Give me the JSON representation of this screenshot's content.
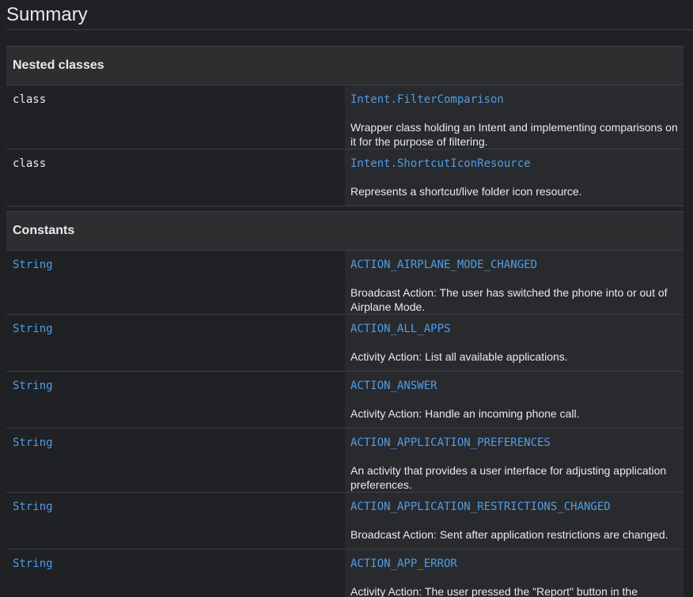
{
  "page": {
    "title": "Summary"
  },
  "nested_classes": {
    "heading": "Nested classes",
    "rows": [
      {
        "type": "class",
        "name": "Intent.FilterComparison",
        "description": "Wrapper class holding an Intent and implementing comparisons on it for the purpose of filtering."
      },
      {
        "type": "class",
        "name": "Intent.ShortcutIconResource",
        "description": "Represents a shortcut/live folder icon resource."
      }
    ]
  },
  "constants": {
    "heading": "Constants",
    "rows": [
      {
        "type": "String",
        "name": "ACTION_AIRPLANE_MODE_CHANGED",
        "description": "Broadcast Action: The user has switched the phone into or out of Airplane Mode."
      },
      {
        "type": "String",
        "name": "ACTION_ALL_APPS",
        "description": "Activity Action: List all available applications."
      },
      {
        "type": "String",
        "name": "ACTION_ANSWER",
        "description": "Activity Action: Handle an incoming phone call."
      },
      {
        "type": "String",
        "name": "ACTION_APPLICATION_PREFERENCES",
        "description": "An activity that provides a user interface for adjusting application preferences."
      },
      {
        "type": "String",
        "name": "ACTION_APPLICATION_RESTRICTIONS_CHANGED",
        "description": "Broadcast Action: Sent after application restrictions are changed."
      },
      {
        "type": "String",
        "name": "ACTION_APP_ERROR",
        "description": "Activity Action: The user pressed the \"Report\" button in the crash/ANR dialog."
      }
    ]
  },
  "colors": {
    "background": "#202124",
    "header_background": "#2d2e30",
    "description_cell_background": "#292a2d",
    "link": "#4f9de8",
    "text": "#e8eaed",
    "divider": "#3c4043"
  }
}
